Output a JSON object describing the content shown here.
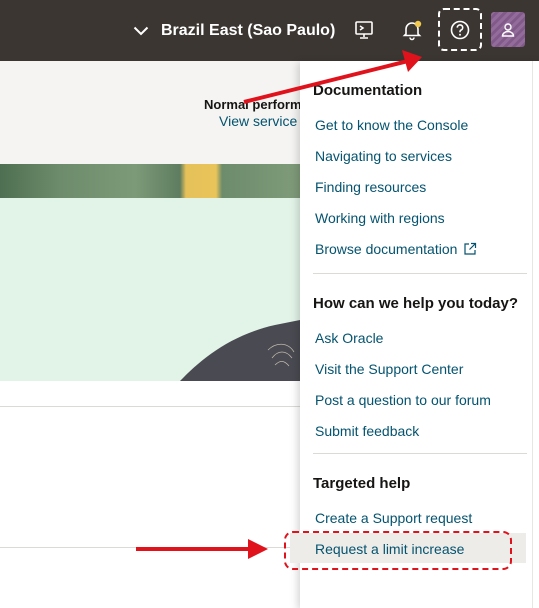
{
  "header": {
    "region_label": "Brazil East (Sao Paulo)",
    "icons": [
      "cloud-shell-icon",
      "bell-icon",
      "help-icon",
      "profile-icon"
    ]
  },
  "background": {
    "status_title": "Normal performance",
    "status_link": "View service"
  },
  "help_menu": {
    "documentation": {
      "heading": "Documentation",
      "links": [
        "Get to know the Console",
        "Navigating to services",
        "Finding resources",
        "Working with regions",
        "Browse documentation"
      ]
    },
    "support": {
      "heading": "How can we help you today?",
      "links": [
        "Ask Oracle",
        "Visit the Support Center",
        "Post a question to our forum",
        "Submit feedback"
      ]
    },
    "targeted": {
      "heading": "Targeted help",
      "links": [
        "Create a Support request",
        "Request a limit increase"
      ]
    }
  },
  "colors": {
    "header_bg": "#3b3632",
    "link": "#04536f",
    "annotation_red": "#e0121c",
    "avatar": "#8a5f93",
    "notification_dot": "#f2c94c"
  }
}
